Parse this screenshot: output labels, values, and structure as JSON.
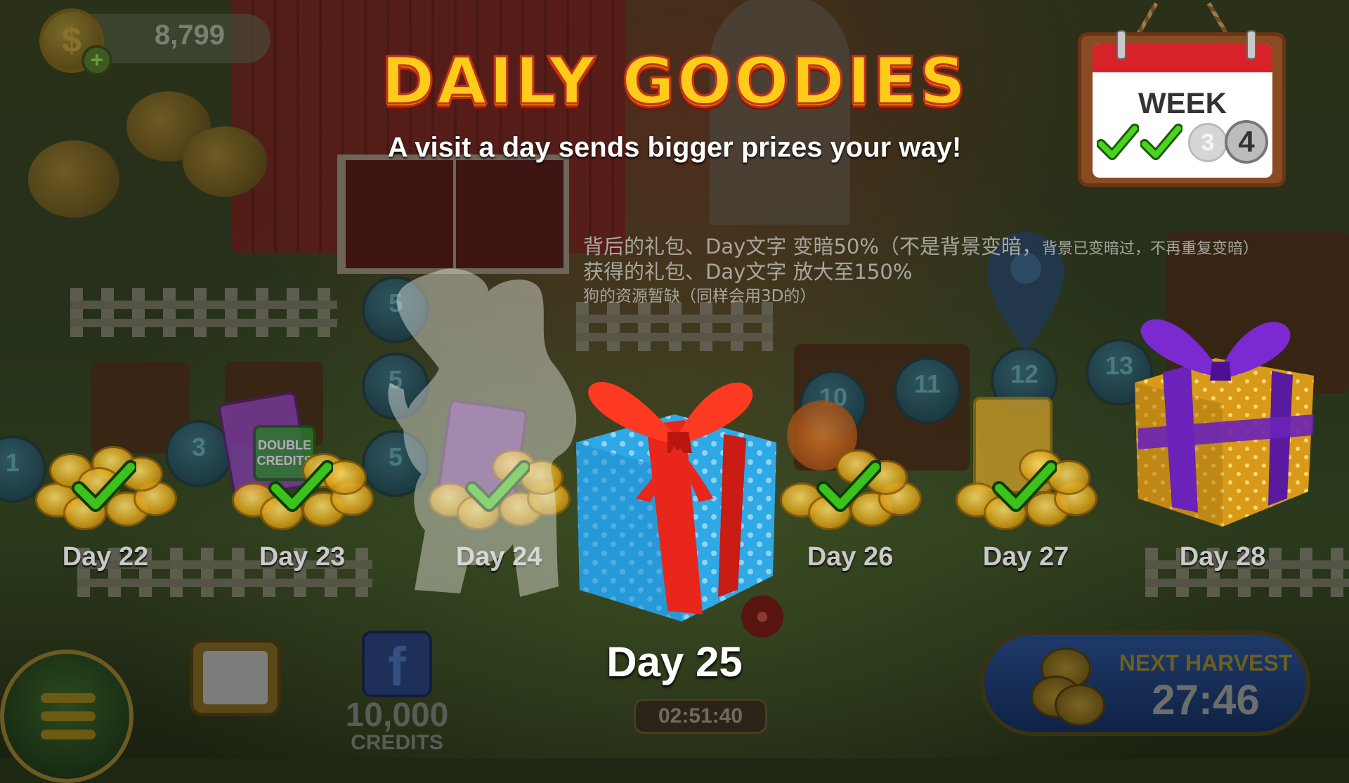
{
  "hud": {
    "coins": "8,799",
    "coin_icon": "$",
    "coin_add_icon": "+"
  },
  "title": "DAILY GOODIES",
  "subtitle": "A visit a day sends bigger prizes your way!",
  "design_notes": {
    "line1_main": "背后的礼包、Day文字 变暗50%（不是背景变暗，",
    "line1_small": "背景已变暗过，不再重复变暗）",
    "line2": "获得的礼包、Day文字 放大至150%",
    "line3": "狗的资源暂缺（同样会用3D的）"
  },
  "week": {
    "label": "WEEK",
    "days": [
      {
        "value": "",
        "state": "done"
      },
      {
        "value": "",
        "state": "done"
      },
      {
        "value": "3",
        "state": "future"
      },
      {
        "value": "4",
        "state": "current"
      }
    ]
  },
  "days": [
    {
      "label": "Day 22",
      "state": "claimed",
      "reward": "coins"
    },
    {
      "label": "Day 23",
      "state": "claimed",
      "reward": "coins + double credits"
    },
    {
      "label": "Day 24",
      "state": "claimed",
      "reward": "coins"
    },
    {
      "label": "Day 25",
      "state": "current",
      "reward": "blue gift box"
    },
    {
      "label": "Day 26",
      "state": "claimed",
      "reward": "coins"
    },
    {
      "label": "Day 27",
      "state": "claimed",
      "reward": "coins"
    },
    {
      "label": "Day 28",
      "state": "upcoming",
      "reward": "gold gift box"
    }
  ],
  "card_text": "DOUBLE CREDITS",
  "background_level_numbers": [
    "5",
    "5",
    "5",
    "3",
    "10",
    "11",
    "12",
    "13",
    "1"
  ],
  "bottom": {
    "facebook_icon": "f",
    "facebook_credits_value": "10,000",
    "facebook_credits_unit": "CREDITS",
    "timer": "02:51:40",
    "next_harvest_label": "NEXT HARVEST",
    "next_harvest_time": "27:46"
  },
  "colors": {
    "title_fill": "#ffcc1a",
    "title_stroke": "#c2341c",
    "check_green": "#3cc21a",
    "calendar_red": "#d8222a",
    "gift_blue": "#2fa8e6",
    "ribbon_red": "#e8261c",
    "gift_gold": "#f0b020",
    "ribbon_purple": "#7a2ad0"
  }
}
